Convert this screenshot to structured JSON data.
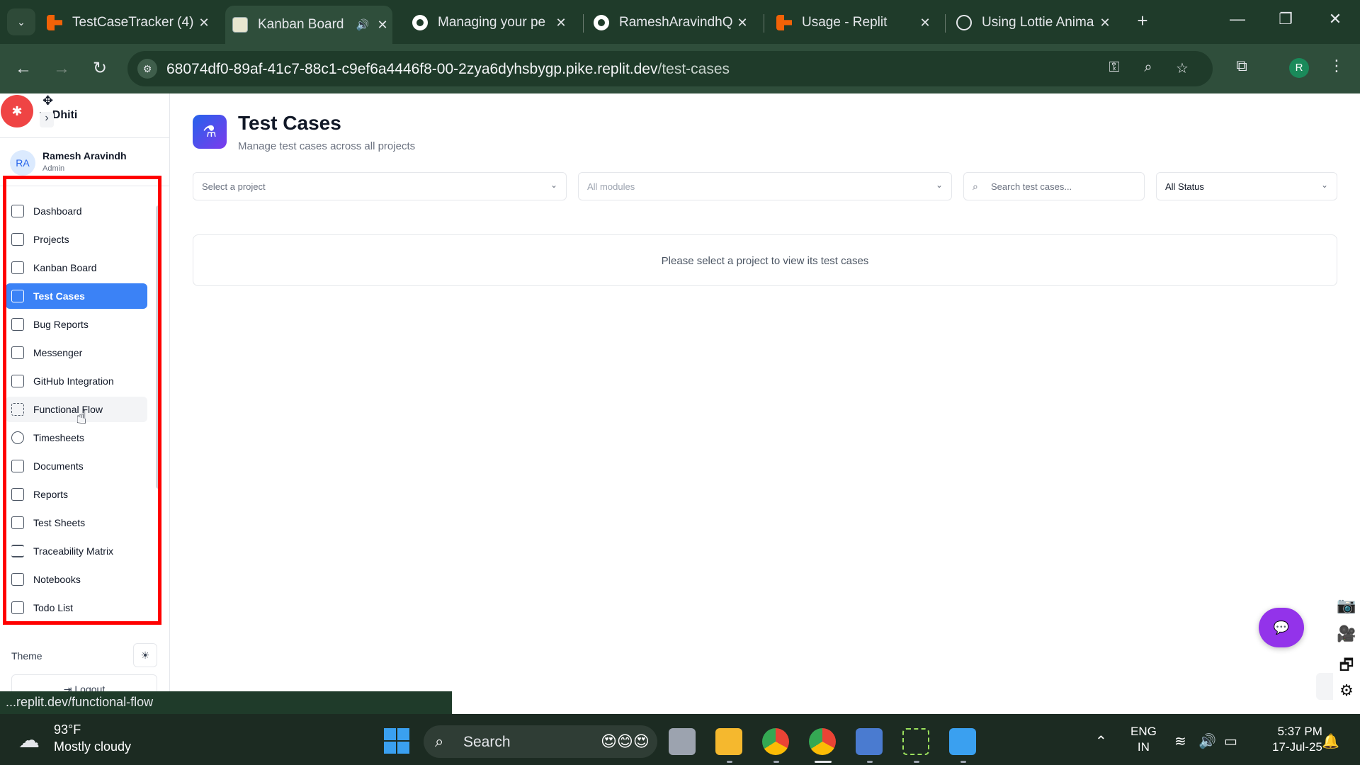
{
  "browser": {
    "tabs": [
      {
        "title": "TestCaseTracker (4)"
      },
      {
        "title": "Kanban Board"
      },
      {
        "title": "Managing your pe"
      },
      {
        "title": "RameshAravindhQ"
      },
      {
        "title": "Usage - Replit"
      },
      {
        "title": "Using Lottie Anima"
      }
    ],
    "url_host": "68074df0-89af-41c7-88c1-c9ef6a4446f8-00-2zya6dyhsbygp.pike.replit.dev",
    "url_path": "/test-cases",
    "profile_initial": "R"
  },
  "sidebar": {
    "brand": "vaDhiti",
    "user": {
      "initials": "RA",
      "name": "Ramesh Aravindh",
      "role": "Admin"
    },
    "items": [
      {
        "label": "Dashboard"
      },
      {
        "label": "Projects"
      },
      {
        "label": "Kanban Board"
      },
      {
        "label": "Test Cases"
      },
      {
        "label": "Bug Reports"
      },
      {
        "label": "Messenger"
      },
      {
        "label": "GitHub Integration"
      },
      {
        "label": "Functional Flow"
      },
      {
        "label": "Timesheets"
      },
      {
        "label": "Documents"
      },
      {
        "label": "Reports"
      },
      {
        "label": "Test Sheets"
      },
      {
        "label": "Traceability Matrix"
      },
      {
        "label": "Notebooks"
      },
      {
        "label": "Todo List"
      }
    ],
    "active_item": "Test Cases",
    "theme_label": "Theme",
    "logout_label": "Logout"
  },
  "main": {
    "title": "Test Cases",
    "subtitle": "Manage test cases across all projects",
    "filters": {
      "project_placeholder": "Select a project",
      "modules_placeholder": "All modules",
      "search_placeholder": "Search test cases...",
      "status_value": "All Status"
    },
    "empty_message": "Please select a project to view its test cases"
  },
  "status_bar": {
    "link": "...replit.dev/functional-flow"
  },
  "taskbar": {
    "weather_temp": "93°F",
    "weather_desc": "Mostly cloudy",
    "search_label": "Search",
    "lang_line1": "ENG",
    "lang_line2": "IN",
    "time": "5:37 PM",
    "date": "17-Jul-25"
  },
  "colors": {
    "active_nav": "#3b82f6",
    "annotation_box": "#ff0000",
    "chat_fab": "#9333ea",
    "bug_fab": "#ef4444"
  }
}
